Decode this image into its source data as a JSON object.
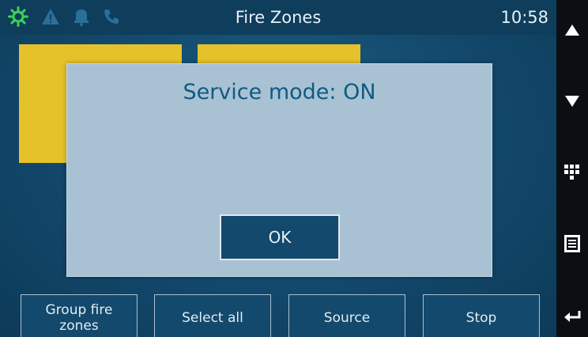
{
  "header": {
    "title": "Fire Zones",
    "clock": "10:58",
    "icons": [
      "settings-gear-icon",
      "warning-triangle-icon",
      "bell-icon",
      "phone-icon"
    ]
  },
  "zones": [
    {
      "label": ""
    },
    {
      "label": ""
    }
  ],
  "dialog": {
    "message": "Service mode: ON",
    "ok_label": "OK"
  },
  "softkeys": {
    "group": "Group fire zones",
    "select_all": "Select all",
    "source": "Source",
    "stop": "Stop"
  },
  "sidebar": {
    "buttons": [
      "arrow-up-icon",
      "arrow-down-icon",
      "keypad-icon",
      "list-icon",
      "back-icon"
    ]
  },
  "colors": {
    "accent_green": "#39d353",
    "zone_yellow": "#e5c22a",
    "screen_blue": "#12486b",
    "dialog_bg": "#a9c2d3",
    "dialog_text": "#0f5a83"
  }
}
